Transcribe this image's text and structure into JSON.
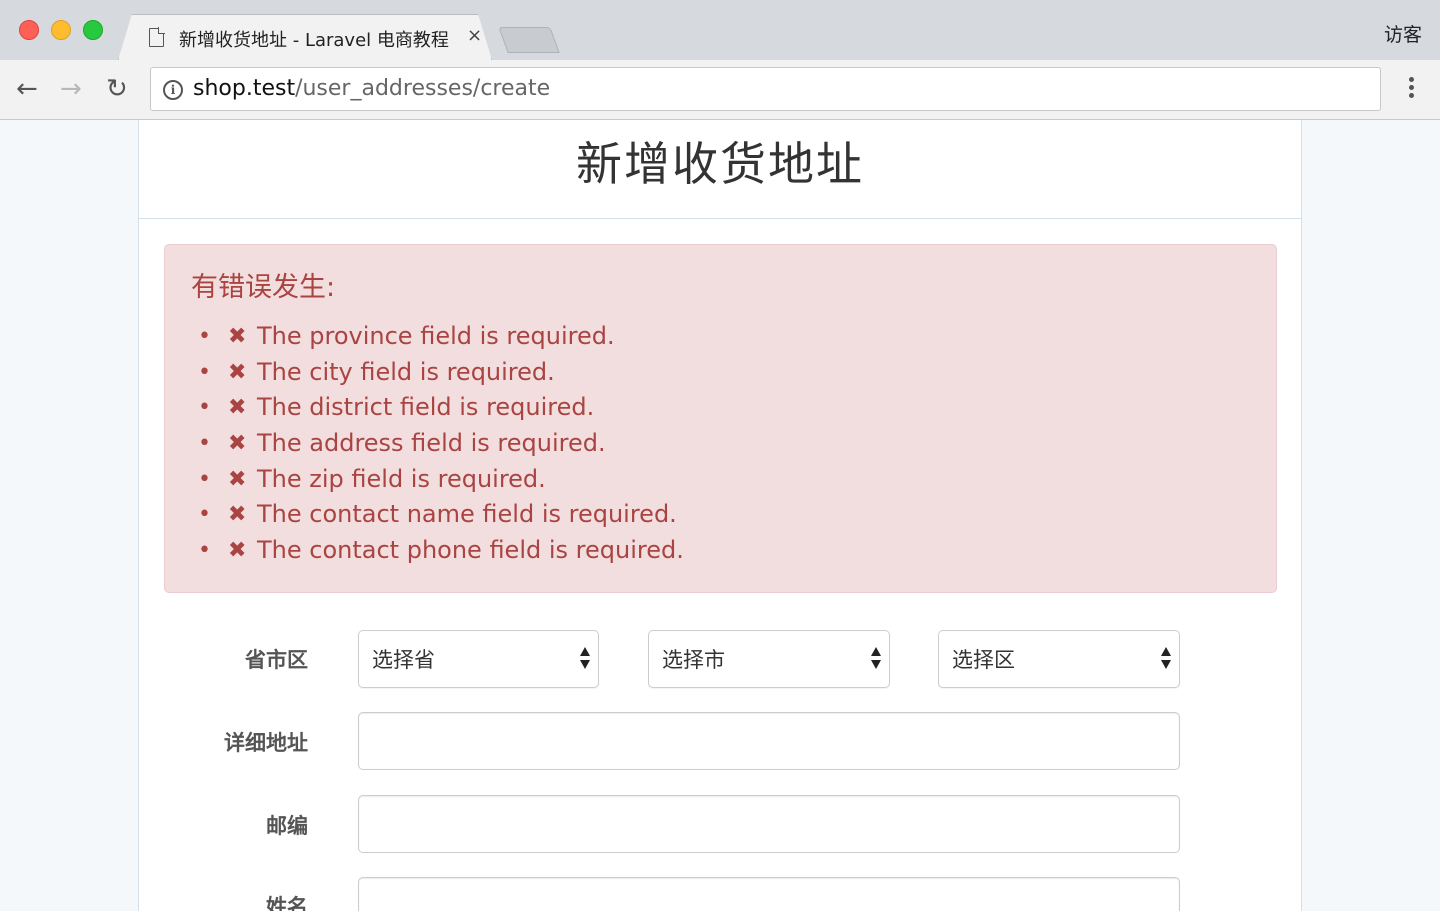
{
  "browser": {
    "tab_title": "新增收货地址 - Laravel 电商教程",
    "tab_close": "×",
    "profile_label": "访客",
    "url_host": "shop.test",
    "url_path": "/user_addresses/create",
    "info_icon": "i"
  },
  "page": {
    "title": "新增收货地址"
  },
  "alert": {
    "title": "有错误发生:",
    "icon": "✖",
    "errors": [
      "The province field is required.",
      "The city field is required.",
      "The district field is required.",
      "The address field is required.",
      "The zip field is required.",
      "The contact name field is required.",
      "The contact phone field is required."
    ]
  },
  "form": {
    "region_label": "省市区",
    "province_placeholder": "选择省",
    "city_placeholder": "选择市",
    "district_placeholder": "选择区",
    "address_label": "详细地址",
    "address_value": "",
    "zip_label": "邮编",
    "zip_value": "",
    "name_label": "姓名",
    "name_value": ""
  },
  "colors": {
    "alert_bg": "#f2dede",
    "alert_text": "#a94442"
  }
}
